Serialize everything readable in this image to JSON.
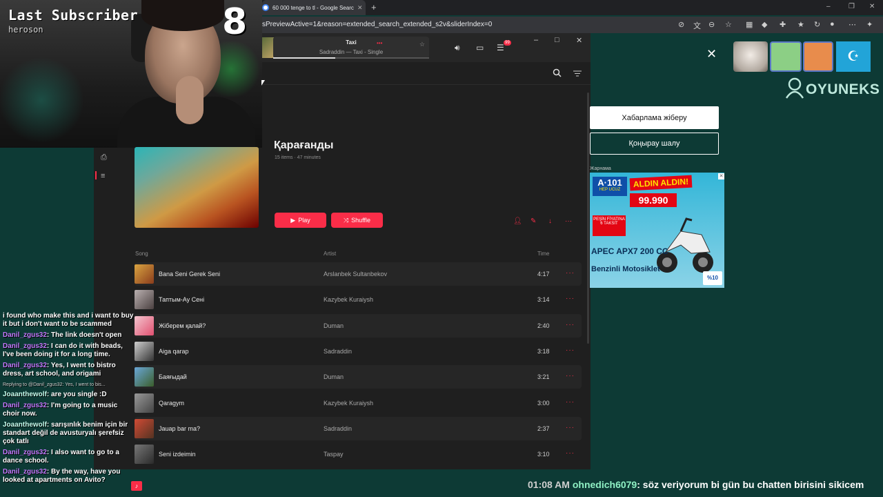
{
  "overlay": {
    "last_subscriber_title": "Last Subscriber",
    "last_subscriber_name": "heroson",
    "sub_count": "8"
  },
  "browser": {
    "tab_title": "60 000 tenge to tl - Google Search",
    "url": "sPreviewActive=1&reason=extended_search_extended_s2v&sliderIndex=0"
  },
  "player": {
    "now_playing_title": "Taxi",
    "now_playing_subtitle": "Sadraddin — Taxi - Single",
    "progress": 0.4,
    "queue_badge": "99"
  },
  "playlist": {
    "title": "Қарағанды",
    "meta": "15 items · 47 minutes",
    "play_label": "Play",
    "shuffle_label": "Shuffle",
    "columns": {
      "song": "Song",
      "artist": "Artist",
      "time": "Time"
    },
    "tracks": [
      {
        "song": "Bana Seni Gerek Seni",
        "artist": "Arslanbek Sultanbekov",
        "time": "4:17"
      },
      {
        "song": "Таптым-Ау Сені",
        "artist": "Kazybek Kuraiysh",
        "time": "3:14"
      },
      {
        "song": "Жіберем қалай?",
        "artist": "Duman",
        "time": "2:40"
      },
      {
        "song": "Aiga qarap",
        "artist": "Sadraddin",
        "time": "3:18"
      },
      {
        "song": "Баяғыдай",
        "artist": "Duman",
        "time": "3:21"
      },
      {
        "song": "Qaragym",
        "artist": "Kazybek Kuraiysh",
        "time": "3:00"
      },
      {
        "song": "Jauap bar ma?",
        "artist": "Sadraddin",
        "time": "2:37"
      },
      {
        "song": "Seni izdeimin",
        "artist": "Taspay",
        "time": "3:10"
      }
    ],
    "more_glyph": "···"
  },
  "right_page": {
    "brand": "OYUNEKS",
    "send_message": "Хабарлама жіберу",
    "call": "Қоңырау шалу",
    "ad_label": "Жарнама",
    "ad": {
      "brand": "A·101",
      "brand_sub": "HEP UCUZ",
      "headline": "ALDIN ALDIN!",
      "price": "99.990",
      "tag": "PEŞİN FİYATINA 6 TAKSİT",
      "model": "APEC APX7 200 CC",
      "model_line2": "Benzinli Motosiklet",
      "badge": "%10"
    }
  },
  "chat": [
    {
      "user": "",
      "text": "i found who make this and i want to buy it but i don't want to be scammed"
    },
    {
      "user": "Danil_zgus32",
      "text": "The link doesn't open"
    },
    {
      "user": "Danil_zgus32",
      "text": "I can do it with beads, I've been doing it for a long time."
    },
    {
      "user": "Danil_zgus32",
      "text": "Yes, I went to bistro dress, art school, and origami"
    },
    {
      "reply": "Replying to @Danil_zgus32: Yes, I went to bis..."
    },
    {
      "user": "Joaanthewolf",
      "text": "are you single :D"
    },
    {
      "user": "Danil_zgus32",
      "text": "I'm going to a music choir now."
    },
    {
      "user": "Joaanthewolf",
      "text": "sarışınlık benim için bir standart değil de avusturyalı şerefsiz çok tatlı"
    },
    {
      "user": "Danil_zgus32",
      "text": "I also want to go to a dance school."
    },
    {
      "user": "Danil_zgus32",
      "text": "By the way, have you looked at apartments on Avito?"
    }
  ],
  "ticker": {
    "time": "01:08 AM",
    "user": "ohnedich6079",
    "message": "söz veriyorum bi gün bu chatten birisini sikicem"
  },
  "colors": {
    "accent": "#fa2d48",
    "background": "#0d3a35",
    "panel": "#1f1f1f"
  }
}
